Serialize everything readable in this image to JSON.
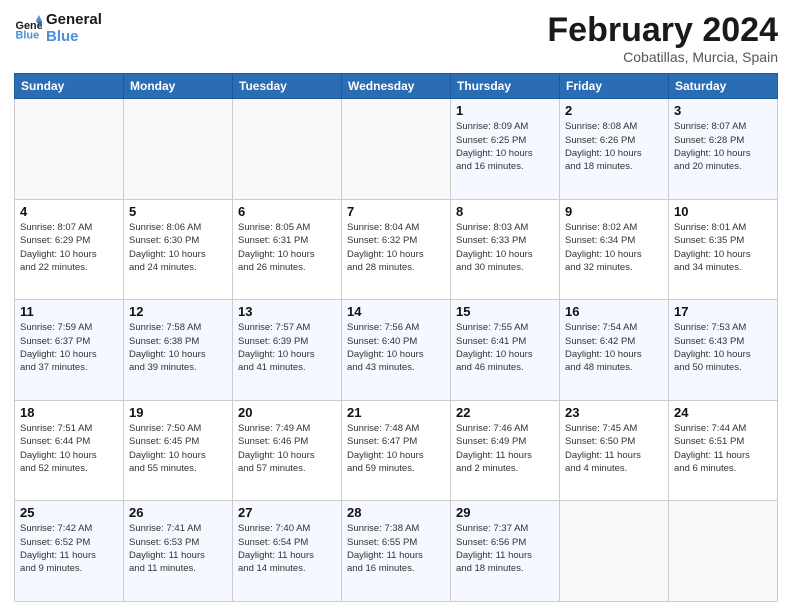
{
  "header": {
    "logo_line1": "General",
    "logo_line2": "Blue",
    "title": "February 2024",
    "subtitle": "Cobatillas, Murcia, Spain"
  },
  "days_of_week": [
    "Sunday",
    "Monday",
    "Tuesday",
    "Wednesday",
    "Thursday",
    "Friday",
    "Saturday"
  ],
  "weeks": [
    [
      {
        "day": "",
        "info": ""
      },
      {
        "day": "",
        "info": ""
      },
      {
        "day": "",
        "info": ""
      },
      {
        "day": "",
        "info": ""
      },
      {
        "day": "1",
        "info": "Sunrise: 8:09 AM\nSunset: 6:25 PM\nDaylight: 10 hours\nand 16 minutes."
      },
      {
        "day": "2",
        "info": "Sunrise: 8:08 AM\nSunset: 6:26 PM\nDaylight: 10 hours\nand 18 minutes."
      },
      {
        "day": "3",
        "info": "Sunrise: 8:07 AM\nSunset: 6:28 PM\nDaylight: 10 hours\nand 20 minutes."
      }
    ],
    [
      {
        "day": "4",
        "info": "Sunrise: 8:07 AM\nSunset: 6:29 PM\nDaylight: 10 hours\nand 22 minutes."
      },
      {
        "day": "5",
        "info": "Sunrise: 8:06 AM\nSunset: 6:30 PM\nDaylight: 10 hours\nand 24 minutes."
      },
      {
        "day": "6",
        "info": "Sunrise: 8:05 AM\nSunset: 6:31 PM\nDaylight: 10 hours\nand 26 minutes."
      },
      {
        "day": "7",
        "info": "Sunrise: 8:04 AM\nSunset: 6:32 PM\nDaylight: 10 hours\nand 28 minutes."
      },
      {
        "day": "8",
        "info": "Sunrise: 8:03 AM\nSunset: 6:33 PM\nDaylight: 10 hours\nand 30 minutes."
      },
      {
        "day": "9",
        "info": "Sunrise: 8:02 AM\nSunset: 6:34 PM\nDaylight: 10 hours\nand 32 minutes."
      },
      {
        "day": "10",
        "info": "Sunrise: 8:01 AM\nSunset: 6:35 PM\nDaylight: 10 hours\nand 34 minutes."
      }
    ],
    [
      {
        "day": "11",
        "info": "Sunrise: 7:59 AM\nSunset: 6:37 PM\nDaylight: 10 hours\nand 37 minutes."
      },
      {
        "day": "12",
        "info": "Sunrise: 7:58 AM\nSunset: 6:38 PM\nDaylight: 10 hours\nand 39 minutes."
      },
      {
        "day": "13",
        "info": "Sunrise: 7:57 AM\nSunset: 6:39 PM\nDaylight: 10 hours\nand 41 minutes."
      },
      {
        "day": "14",
        "info": "Sunrise: 7:56 AM\nSunset: 6:40 PM\nDaylight: 10 hours\nand 43 minutes."
      },
      {
        "day": "15",
        "info": "Sunrise: 7:55 AM\nSunset: 6:41 PM\nDaylight: 10 hours\nand 46 minutes."
      },
      {
        "day": "16",
        "info": "Sunrise: 7:54 AM\nSunset: 6:42 PM\nDaylight: 10 hours\nand 48 minutes."
      },
      {
        "day": "17",
        "info": "Sunrise: 7:53 AM\nSunset: 6:43 PM\nDaylight: 10 hours\nand 50 minutes."
      }
    ],
    [
      {
        "day": "18",
        "info": "Sunrise: 7:51 AM\nSunset: 6:44 PM\nDaylight: 10 hours\nand 52 minutes."
      },
      {
        "day": "19",
        "info": "Sunrise: 7:50 AM\nSunset: 6:45 PM\nDaylight: 10 hours\nand 55 minutes."
      },
      {
        "day": "20",
        "info": "Sunrise: 7:49 AM\nSunset: 6:46 PM\nDaylight: 10 hours\nand 57 minutes."
      },
      {
        "day": "21",
        "info": "Sunrise: 7:48 AM\nSunset: 6:47 PM\nDaylight: 10 hours\nand 59 minutes."
      },
      {
        "day": "22",
        "info": "Sunrise: 7:46 AM\nSunset: 6:49 PM\nDaylight: 11 hours\nand 2 minutes."
      },
      {
        "day": "23",
        "info": "Sunrise: 7:45 AM\nSunset: 6:50 PM\nDaylight: 11 hours\nand 4 minutes."
      },
      {
        "day": "24",
        "info": "Sunrise: 7:44 AM\nSunset: 6:51 PM\nDaylight: 11 hours\nand 6 minutes."
      }
    ],
    [
      {
        "day": "25",
        "info": "Sunrise: 7:42 AM\nSunset: 6:52 PM\nDaylight: 11 hours\nand 9 minutes."
      },
      {
        "day": "26",
        "info": "Sunrise: 7:41 AM\nSunset: 6:53 PM\nDaylight: 11 hours\nand 11 minutes."
      },
      {
        "day": "27",
        "info": "Sunrise: 7:40 AM\nSunset: 6:54 PM\nDaylight: 11 hours\nand 14 minutes."
      },
      {
        "day": "28",
        "info": "Sunrise: 7:38 AM\nSunset: 6:55 PM\nDaylight: 11 hours\nand 16 minutes."
      },
      {
        "day": "29",
        "info": "Sunrise: 7:37 AM\nSunset: 6:56 PM\nDaylight: 11 hours\nand 18 minutes."
      },
      {
        "day": "",
        "info": ""
      },
      {
        "day": "",
        "info": ""
      }
    ]
  ]
}
